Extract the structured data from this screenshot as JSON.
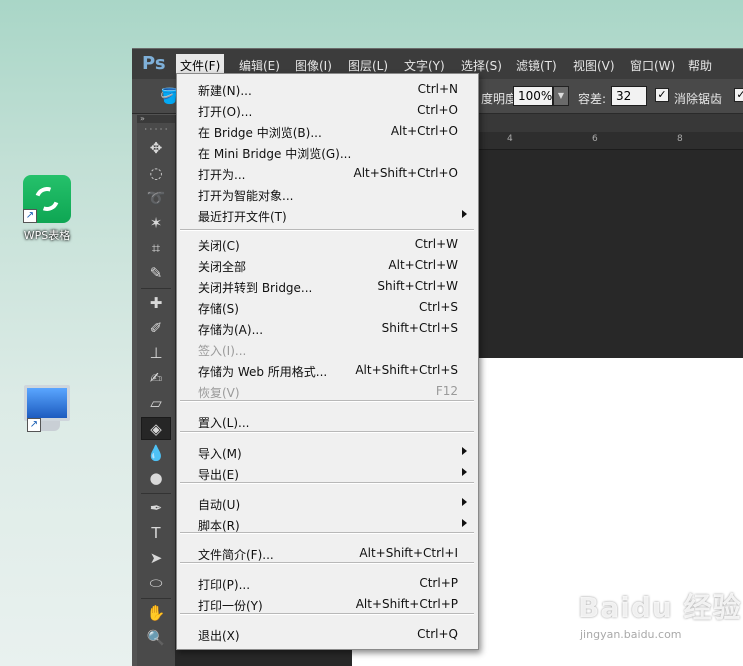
{
  "desktop": {
    "wps_label": "WPS表格"
  },
  "photoshop": {
    "logo": "Ps",
    "menubar": [
      "文件(F)",
      "编辑(E)",
      "图像(I)",
      "图层(L)",
      "文字(Y)",
      "选择(S)",
      "滤镜(T)",
      "视图(V)",
      "窗口(W)",
      "帮助"
    ],
    "options": {
      "opacity_label": "度明度:",
      "opacity_value": "100%",
      "tolerance_label": "容差:",
      "tolerance_value": "32",
      "antialias_label": "消除锯齿"
    },
    "ruler_numbers": [
      "4",
      "6",
      "8"
    ]
  },
  "file_menu": {
    "items": [
      {
        "label": "新建(N)...",
        "shortcut": "Ctrl+N",
        "submenu": false,
        "disabled": false
      },
      {
        "label": "打开(O)...",
        "shortcut": "Ctrl+O",
        "submenu": false,
        "disabled": false
      },
      {
        "label": "在 Bridge 中浏览(B)...",
        "shortcut": "Alt+Ctrl+O",
        "submenu": false,
        "disabled": false
      },
      {
        "label": "在 Mini Bridge 中浏览(G)...",
        "shortcut": "",
        "submenu": false,
        "disabled": false
      },
      {
        "label": "打开为...",
        "shortcut": "Alt+Shift+Ctrl+O",
        "submenu": false,
        "disabled": false
      },
      {
        "label": "打开为智能对象...",
        "shortcut": "",
        "submenu": false,
        "disabled": false
      },
      {
        "label": "最近打开文件(T)",
        "shortcut": "",
        "submenu": true,
        "disabled": false
      },
      {
        "label": "关闭(C)",
        "shortcut": "Ctrl+W",
        "submenu": false,
        "disabled": false
      },
      {
        "label": "关闭全部",
        "shortcut": "Alt+Ctrl+W",
        "submenu": false,
        "disabled": false
      },
      {
        "label": "关闭并转到 Bridge...",
        "shortcut": "Shift+Ctrl+W",
        "submenu": false,
        "disabled": false
      },
      {
        "label": "存储(S)",
        "shortcut": "Ctrl+S",
        "submenu": false,
        "disabled": false
      },
      {
        "label": "存储为(A)...",
        "shortcut": "Shift+Ctrl+S",
        "submenu": false,
        "disabled": false
      },
      {
        "label": "签入(I)...",
        "shortcut": "",
        "submenu": false,
        "disabled": true
      },
      {
        "label": "存储为 Web 所用格式...",
        "shortcut": "Alt+Shift+Ctrl+S",
        "submenu": false,
        "disabled": false
      },
      {
        "label": "恢复(V)",
        "shortcut": "F12",
        "submenu": false,
        "disabled": true
      },
      {
        "label": "置入(L)...",
        "shortcut": "",
        "submenu": false,
        "disabled": false
      },
      {
        "label": "导入(M)",
        "shortcut": "",
        "submenu": true,
        "disabled": false
      },
      {
        "label": "导出(E)",
        "shortcut": "",
        "submenu": true,
        "disabled": false
      },
      {
        "label": "自动(U)",
        "shortcut": "",
        "submenu": true,
        "disabled": false
      },
      {
        "label": "脚本(R)",
        "shortcut": "",
        "submenu": true,
        "disabled": false
      },
      {
        "label": "文件简介(F)...",
        "shortcut": "Alt+Shift+Ctrl+I",
        "submenu": false,
        "disabled": false
      },
      {
        "label": "打印(P)...",
        "shortcut": "Ctrl+P",
        "submenu": false,
        "disabled": false
      },
      {
        "label": "打印一份(Y)",
        "shortcut": "Alt+Shift+Ctrl+P",
        "submenu": false,
        "disabled": false
      },
      {
        "label": "退出(X)",
        "shortcut": "Ctrl+Q",
        "submenu": false,
        "disabled": false
      }
    ]
  },
  "watermark": {
    "text": "Baidu 经验",
    "url": "jingyan.baidu.com"
  },
  "colors": {
    "menu_bg": "#f0f0f0",
    "ps_chrome": "#535353",
    "ps_menubar": "#3c3c3c",
    "wps_green": "#19b35e"
  }
}
